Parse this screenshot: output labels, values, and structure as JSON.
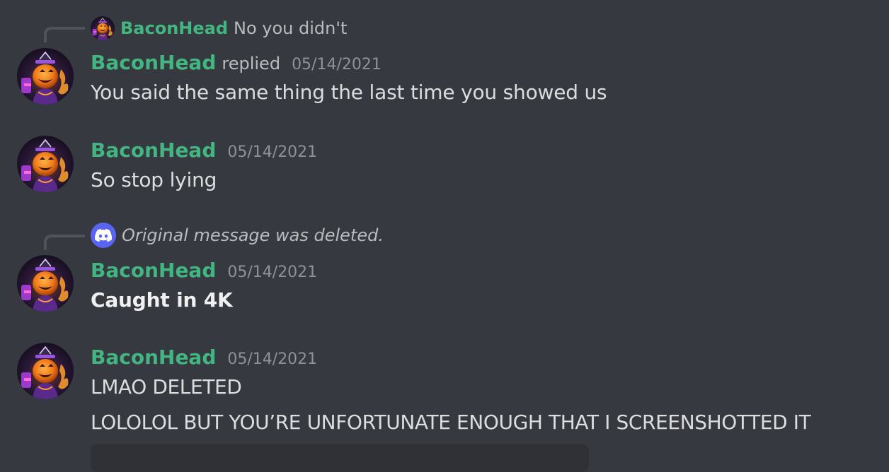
{
  "colors": {
    "background": "#36393f",
    "author": "#43b581",
    "timestamp": "#8e9297",
    "text": "#dcddde",
    "discord_blurple": "#5865f2"
  },
  "messages": [
    {
      "reply": {
        "author": "BaconHead",
        "text": "No you didn't"
      },
      "author": "BaconHead",
      "replied_label": "replied",
      "timestamp": "05/14/2021",
      "text": "You said the same thing the last time you showed us"
    },
    {
      "author": "BaconHead",
      "timestamp": "05/14/2021",
      "text": "So stop lying"
    },
    {
      "reply_deleted": "Original message was deleted.",
      "author": "BaconHead",
      "timestamp": "05/14/2021",
      "text": "Caught in 4K"
    },
    {
      "author": "BaconHead",
      "timestamp": "05/14/2021",
      "lines": [
        "LMAO DELETED",
        "LOLOLOL BUT YOU’RE UNFORTUNATE ENOUGH THAT I SCREENSHOTTED IT"
      ]
    }
  ]
}
